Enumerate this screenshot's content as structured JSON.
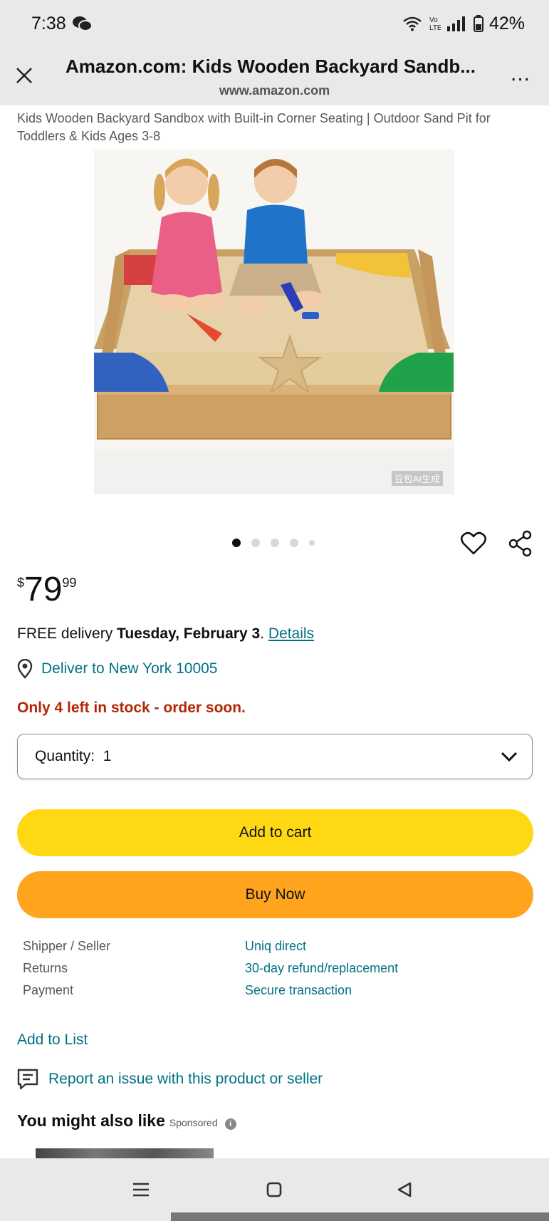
{
  "status_bar": {
    "time": "7:38",
    "battery": "42%",
    "icons": [
      "wechat-icon",
      "wifi-icon",
      "volte-icon",
      "signal-icon",
      "battery-icon"
    ]
  },
  "browser": {
    "title": "Amazon.com: Kids Wooden Backyard Sandb...",
    "url": "www.amazon.com",
    "more_label": "..."
  },
  "product": {
    "title": "Kids Wooden Backyard Sandbox with Built-in Corner Seating | Outdoor Sand Pit for Toddlers & Kids Ages 3-8",
    "image_watermark": "豆包AI生成",
    "carousel": {
      "count": 5,
      "active_index": 0
    }
  },
  "price": {
    "symbol": "$",
    "whole": "79",
    "fraction": "99"
  },
  "delivery": {
    "prefix": "FREE delivery ",
    "date": "Tuesday, February 3",
    "separator": ". ",
    "details_link": "Details"
  },
  "deliver_to": "Deliver to New York 10005",
  "stock_message": "Only 4 left in stock - order soon.",
  "quantity": {
    "label": "Quantity:",
    "value": "1"
  },
  "buttons": {
    "add_to_cart": "Add to cart",
    "buy_now": "Buy Now"
  },
  "info_rows": [
    {
      "label": "Shipper / Seller",
      "value": "Uniq direct"
    },
    {
      "label": "Returns",
      "value": "30-day refund/replacement"
    },
    {
      "label": "Payment",
      "value": "Secure transaction"
    }
  ],
  "add_to_list": "Add to List",
  "report_issue": "Report an issue with this product or seller",
  "you_might_like": {
    "heading": "You might also like",
    "sponsored": "Sponsored"
  },
  "colors": {
    "link": "#007185",
    "stock": "#b12704",
    "add_to_cart_bg": "#ffd814",
    "buy_now_bg": "#ffa41c",
    "chrome_bg": "#e9e9eb"
  }
}
